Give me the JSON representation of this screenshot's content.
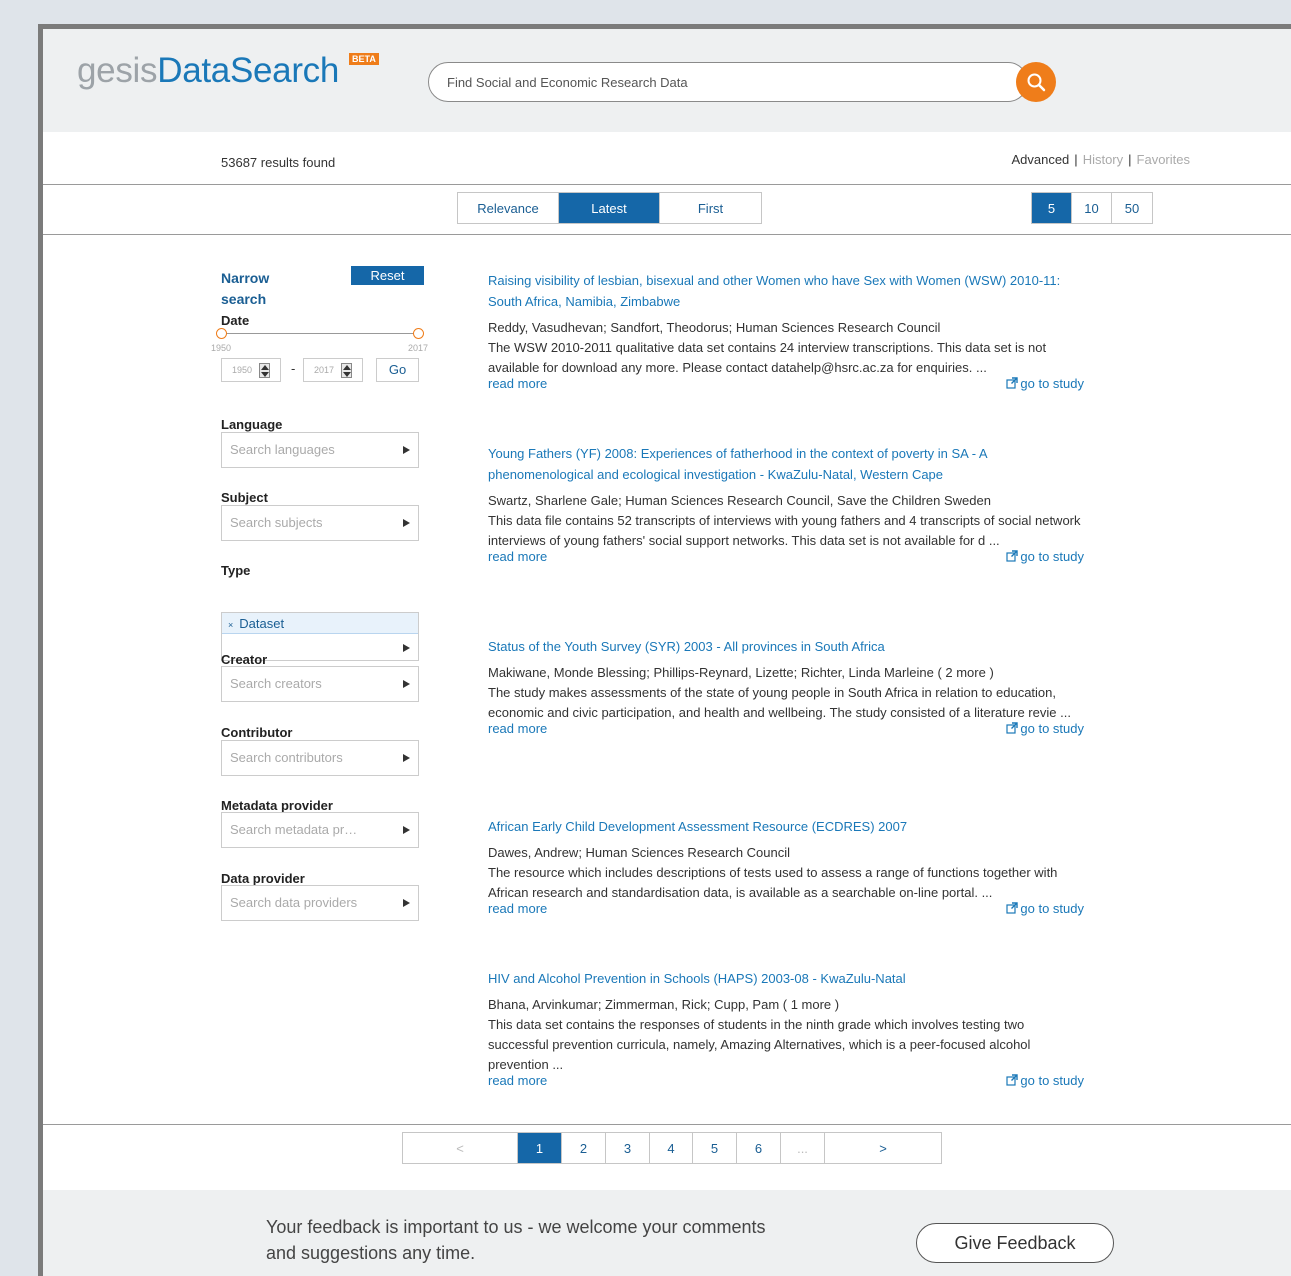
{
  "header": {
    "logo_gesis": "gesis",
    "logo_datasearch": "DataSearch",
    "beta": "BETA",
    "search_placeholder": "Find Social and Economic Research Data"
  },
  "subheader": {
    "results_count": "53687 results found",
    "advanced": "Advanced",
    "history": "History",
    "favorites": "Favorites",
    "sep": "|"
  },
  "sort": {
    "options": [
      "Relevance",
      "Latest",
      "First"
    ],
    "active": "Latest"
  },
  "page_size": {
    "options": [
      "5",
      "10",
      "50"
    ],
    "active": "5"
  },
  "sidebar": {
    "narrow_title": "Narrow search",
    "reset": "Reset",
    "date": {
      "label": "Date",
      "min": "1950",
      "max": "2017",
      "from_value": "1950",
      "to_value": "2017",
      "dash": "-",
      "go": "Go"
    },
    "language": {
      "label": "Language",
      "placeholder": "Search languages"
    },
    "subject": {
      "label": "Subject",
      "placeholder": "Search subjects"
    },
    "type": {
      "label": "Type",
      "selected": "Dataset",
      "remove": "×"
    },
    "creator": {
      "label": "Creator",
      "placeholder": "Search creators"
    },
    "contributor": {
      "label": "Contributor",
      "placeholder": "Search contributors"
    },
    "metadata_provider": {
      "label": "Metadata provider",
      "placeholder": "Search metadata pr…"
    },
    "data_provider": {
      "label": "Data provider",
      "placeholder": "Search data providers"
    }
  },
  "results": [
    {
      "title": "Raising visibility of lesbian, bisexual and other Women who have Sex with Women (WSW) 2010-11: South Africa, Namibia, Zimbabwe",
      "authors": "Reddy, Vasudhevan; Sandfort, Theodorus; Human Sciences Research Council",
      "description": "The WSW 2010-2011 qualitative data set contains 24 interview transcriptions. This data set is not available for download any more. Please contact datahelp@hsrc.ac.za for enquiries. ...",
      "read_more": "read more",
      "go_to_study": "go to study"
    },
    {
      "title": "Young Fathers (YF) 2008: Experiences of fatherhood in the context of poverty in SA - A phenomenological and ecological investigation - KwaZulu-Natal, Western Cape",
      "authors": "Swartz, Sharlene Gale; Human Sciences Research Council, Save the Children Sweden",
      "description": "This data file contains 52 transcripts of interviews with young fathers and 4 transcripts of social network interviews of young fathers' social support networks. This data set is not available for d ...",
      "read_more": "read more",
      "go_to_study": "go to study"
    },
    {
      "title": "Status of the Youth Survey (SYR) 2003 - All provinces in South Africa",
      "authors": "Makiwane, Monde Blessing; Phillips-Reynard, Lizette; Richter, Linda Marleine ( 2 more )",
      "description": "The study makes assessments of the state of young people in South Africa in relation to education, economic and civic participation, and health and wellbeing. The study consisted of a literature revie ...",
      "read_more": "read more",
      "go_to_study": "go to study"
    },
    {
      "title": "African Early Child Development Assessment Resource (ECDRES) 2007",
      "authors": "Dawes, Andrew; Human Sciences Research Council",
      "description": "The resource which includes descriptions of tests used to assess a range of functions together with African research and standardisation data, is available as a searchable on-line portal. ...",
      "read_more": "read more",
      "go_to_study": "go to study"
    },
    {
      "title": "HIV and Alcohol Prevention in Schools (HAPS) 2003-08 - KwaZulu-Natal",
      "authors": "Bhana, Arvinkumar; Zimmerman, Rick; Cupp, Pam ( 1 more )",
      "description": "This data set contains the responses of students in the ninth grade which involves testing two successful prevention curricula, namely, Amazing Alternatives, which is a peer-focused alcohol prevention ...",
      "read_more": "read more",
      "go_to_study": "go to study"
    }
  ],
  "pagination": {
    "prev": "<",
    "pages": [
      "1",
      "2",
      "3",
      "4",
      "5",
      "6"
    ],
    "ellipsis": "...",
    "next": ">",
    "active": "1"
  },
  "footer": {
    "feedback_text": "Your feedback is important to us - we welcome your comments and suggestions any time.",
    "feedback_button": "Give Feedback"
  },
  "colors": {
    "accent_blue": "#1567a8",
    "link_blue": "#1a78b8",
    "orange": "#ef7d1a"
  }
}
